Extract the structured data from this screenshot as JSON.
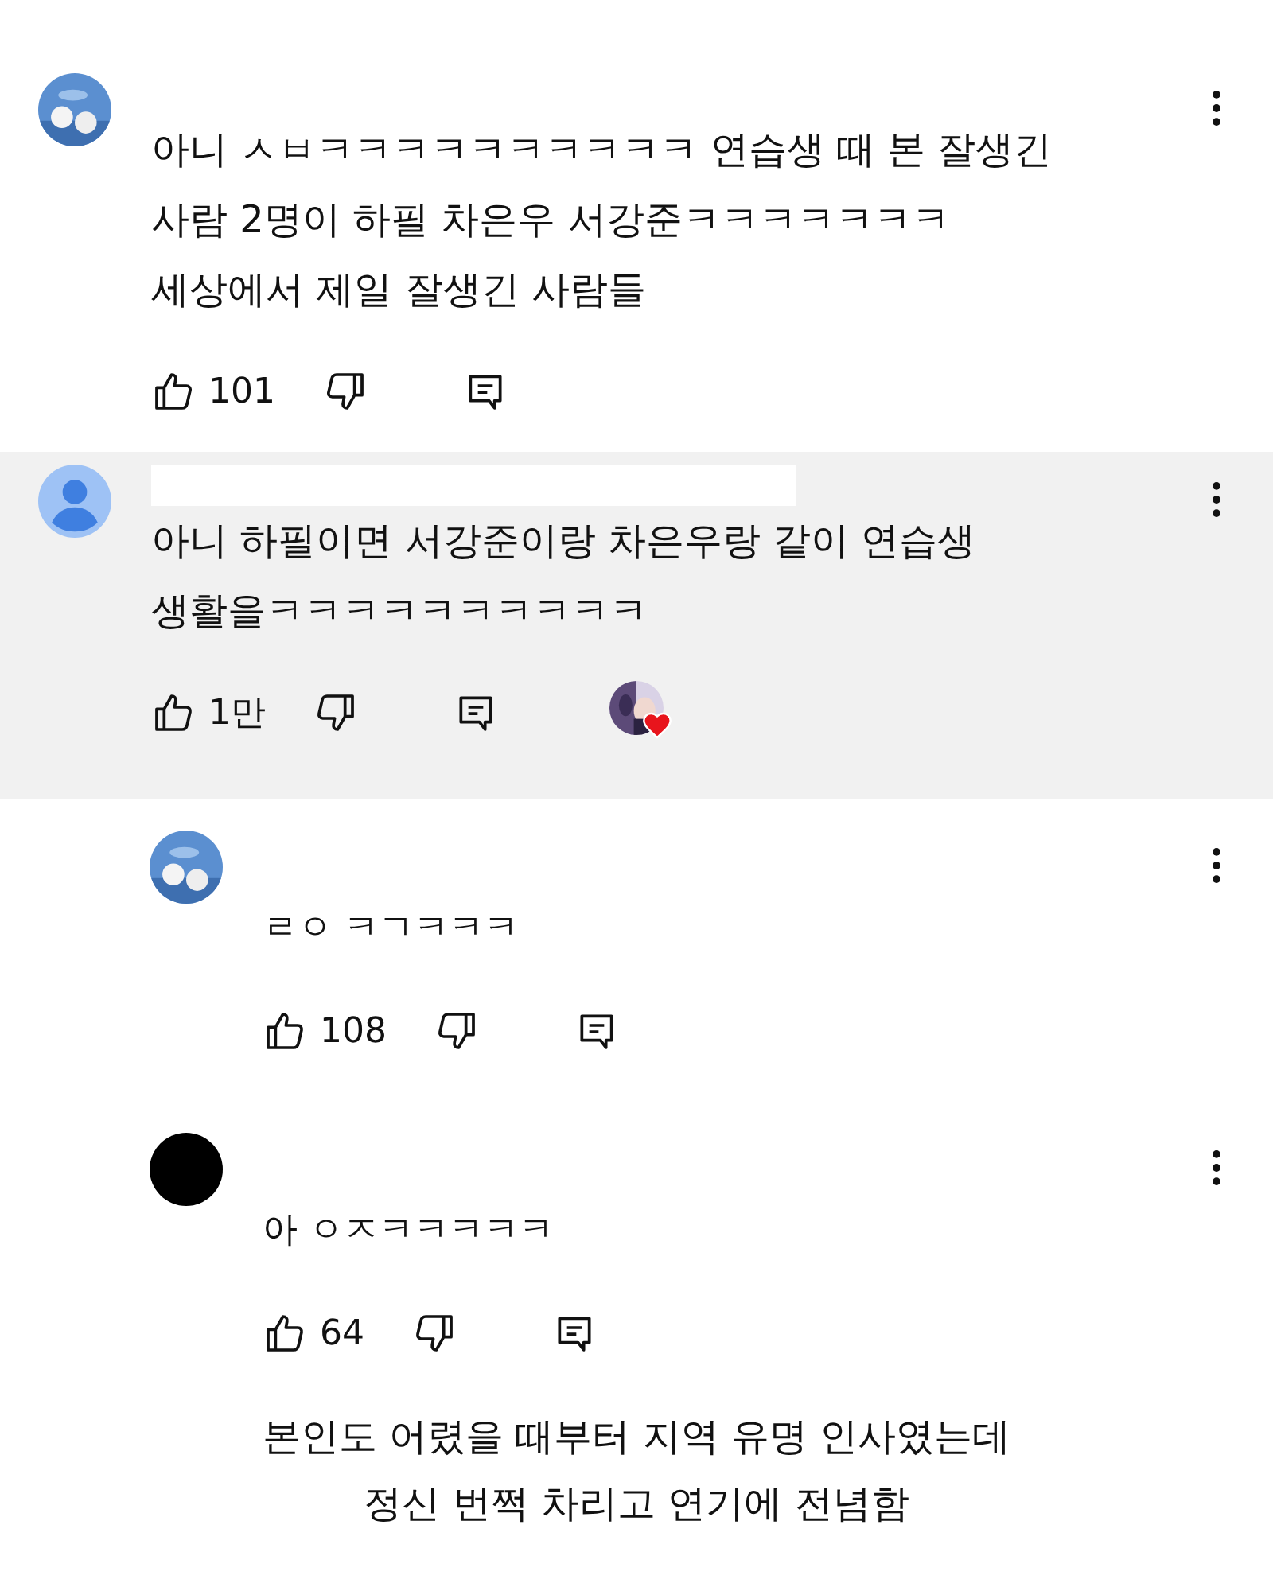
{
  "comments": [
    {
      "name_redacted": false,
      "highlighted": false,
      "text": "아니 ㅅㅂㅋㅋㅋㅋㅋㅋㅋㅋㅋㅋ 연습생 때 본 잘생긴\n사람 2명이 하필 차은우 서강준ㅋㅋㅋㅋㅋㅋㅋ\n세상에서 제일 잘생긴 사람들",
      "likes": "101",
      "creator_heart": false
    },
    {
      "avatar": {
        "kind": "default"
      },
      "name_redacted": true,
      "highlighted": true,
      "text": "아니 하필이면 서강준이랑 차은우랑 같이 연습생\n생활을ㅋㅋㅋㅋㅋㅋㅋㅋㅋㅋ",
      "likes": "1만",
      "creator_heart": true,
      "replies": [
        {
          "name_redacted": false,
          "highlighted": false,
          "text": "ㄹㅇ ㅋㄱㅋㅋㅋ",
          "likes": "108",
          "creator_heart": false
        },
        {
          "avatar": {
            "kind": "blank"
          },
          "name_redacted": false,
          "highlighted": false,
          "text": "아 ㅇㅈㅋㅋㅋㅋㅋ",
          "likes": "64",
          "creator_heart": false
        }
      ]
    }
  ],
  "caption": [
    "본인도 어렸을 때부터 지역 유명 인사였는데",
    "정신 번쩍 차리고 연기에 전념함"
  ]
}
